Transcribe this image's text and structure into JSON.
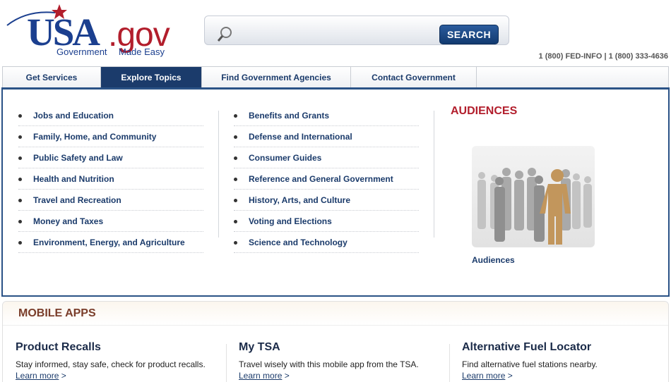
{
  "logo": {
    "usa": "USA",
    "gov": ".gov",
    "tagline_1": "Government",
    "tagline_2": "Made Easy"
  },
  "search": {
    "placeholder": "",
    "button_label": "SEARCH"
  },
  "phones": {
    "prefix_1": "1",
    "number_1": " (800) FED-INFO",
    "separator": " | ",
    "prefix_2": "1",
    "number_2": " (800) 333-4636"
  },
  "nav": {
    "tabs": [
      {
        "label": "Get Services"
      },
      {
        "label": "Explore Topics"
      },
      {
        "label": "Find Government Agencies"
      },
      {
        "label": "Contact Government"
      }
    ]
  },
  "topics": {
    "column1": [
      "Jobs and Education",
      "Family, Home, and Community",
      "Public Safety and Law",
      "Health and Nutrition",
      "Travel and Recreation",
      "Money and Taxes",
      "Environment, Energy, and Agriculture"
    ],
    "column2": [
      "Benefits and Grants",
      "Defense and International",
      "Consumer Guides",
      "Reference and General Government",
      "History, Arts, and Culture",
      "Voting and Elections",
      "Science and Technology"
    ]
  },
  "audiences": {
    "heading": "AUDIENCES",
    "label": "Audiences"
  },
  "mobile_apps": {
    "title": "MOBILE APPS",
    "apps": [
      {
        "title": "Product Recalls",
        "description": "Stay informed, stay safe, check for product recalls.",
        "link": "Learn more",
        "arrow": " >"
      },
      {
        "title": "My TSA",
        "description": "Travel wisely with this mobile app from the TSA.",
        "link": "Learn more",
        "arrow": " >"
      },
      {
        "title": "Alternative Fuel Locator",
        "description": "Find alternative fuel stations nearby.",
        "link": "Learn more",
        "arrow": " >"
      }
    ]
  },
  "colors": {
    "brand_blue": "#1b3f8f",
    "brand_red": "#b21e2c",
    "nav_active": "#1b3b6b"
  }
}
